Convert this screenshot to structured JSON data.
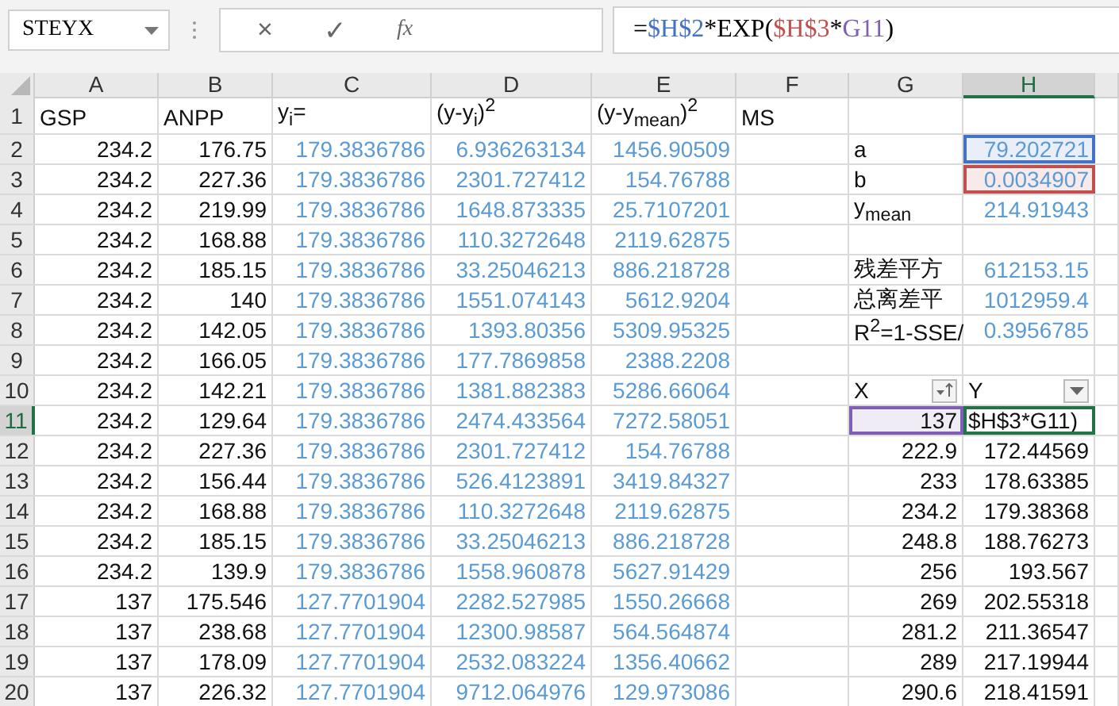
{
  "formula_bar": {
    "name_box": "STEYX",
    "cancel": "×",
    "enter": "✓",
    "function": "fx",
    "formula": [
      {
        "text": "=",
        "color": "#000000"
      },
      {
        "text": "$H$2",
        "color": "#4472c4"
      },
      {
        "text": "*EXP(",
        "color": "#000000"
      },
      {
        "text": "$H$3",
        "color": "#c0504d"
      },
      {
        "text": "*",
        "color": "#000000"
      },
      {
        "text": "G11",
        "color": "#7f5fb5"
      },
      {
        "text": ")",
        "color": "#000000"
      }
    ]
  },
  "columns": [
    {
      "label": "A",
      "selected": false
    },
    {
      "label": "B",
      "selected": false
    },
    {
      "label": "C",
      "selected": false
    },
    {
      "label": "D",
      "selected": false
    },
    {
      "label": "E",
      "selected": false
    },
    {
      "label": "F",
      "selected": false
    },
    {
      "label": "G",
      "selected": false
    },
    {
      "label": "H",
      "selected": true
    }
  ],
  "rows": [
    {
      "number": "1",
      "selected": false,
      "cells": [
        {
          "kind": "label",
          "text": "GSP"
        },
        {
          "kind": "label",
          "text": "ANPP"
        },
        {
          "kind": "label",
          "text": "y$_{i}$="
        },
        {
          "kind": "label",
          "text": "(y-y$_{i}$)$^{2}$"
        },
        {
          "kind": "label",
          "text": "(y-y$_{mean}$)$^{2}$"
        },
        {
          "kind": "label",
          "text": "MS"
        },
        {
          "kind": "empty"
        },
        {
          "kind": "empty"
        }
      ]
    },
    {
      "number": "2",
      "selected": false,
      "cells": [
        {
          "kind": "number",
          "text": "234.2"
        },
        {
          "kind": "number",
          "text": "176.75"
        },
        {
          "kind": "calc",
          "text": "179.3836786"
        },
        {
          "kind": "calc",
          "text": "6.936263134"
        },
        {
          "kind": "calc",
          "text": "1456.90509"
        },
        {
          "kind": "empty"
        },
        {
          "kind": "label",
          "text": "a"
        },
        {
          "kind": "calc",
          "text": "79.202721",
          "color": "#4472c4"
        }
      ]
    },
    {
      "number": "3",
      "selected": false,
      "cells": [
        {
          "kind": "number",
          "text": "234.2"
        },
        {
          "kind": "number",
          "text": "227.36"
        },
        {
          "kind": "calc",
          "text": "179.3836786"
        },
        {
          "kind": "calc",
          "text": "2301.727412"
        },
        {
          "kind": "calc",
          "text": "154.76788"
        },
        {
          "kind": "empty"
        },
        {
          "kind": "label",
          "text": "b"
        },
        {
          "kind": "calc",
          "text": "0.0034907",
          "color": "#c0504d"
        }
      ]
    },
    {
      "number": "4",
      "selected": false,
      "cells": [
        {
          "kind": "number",
          "text": "234.2"
        },
        {
          "kind": "number",
          "text": "219.99"
        },
        {
          "kind": "calc",
          "text": "179.3836786"
        },
        {
          "kind": "calc",
          "text": "1648.873335"
        },
        {
          "kind": "calc",
          "text": "25.7107201"
        },
        {
          "kind": "empty"
        },
        {
          "kind": "label",
          "text": "y$_{mean}$"
        },
        {
          "kind": "calc",
          "text": "214.91943"
        }
      ]
    },
    {
      "number": "5",
      "selected": false,
      "cells": [
        {
          "kind": "number",
          "text": "234.2"
        },
        {
          "kind": "number",
          "text": "168.88"
        },
        {
          "kind": "calc",
          "text": "179.3836786"
        },
        {
          "kind": "calc",
          "text": "110.3272648"
        },
        {
          "kind": "calc",
          "text": "2119.62875"
        },
        {
          "kind": "empty"
        },
        {
          "kind": "empty"
        },
        {
          "kind": "empty"
        }
      ]
    },
    {
      "number": "6",
      "selected": false,
      "cells": [
        {
          "kind": "number",
          "text": "234.2"
        },
        {
          "kind": "number",
          "text": "185.15"
        },
        {
          "kind": "calc",
          "text": "179.3836786"
        },
        {
          "kind": "calc",
          "text": "33.25046213"
        },
        {
          "kind": "calc",
          "text": "886.218728"
        },
        {
          "kind": "empty"
        },
        {
          "kind": "label",
          "text": "残差平方"
        },
        {
          "kind": "calc",
          "text": "612153.15"
        }
      ]
    },
    {
      "number": "7",
      "selected": false,
      "cells": [
        {
          "kind": "number",
          "text": "234.2"
        },
        {
          "kind": "number",
          "text": "140"
        },
        {
          "kind": "calc",
          "text": "179.3836786"
        },
        {
          "kind": "calc",
          "text": "1551.074143"
        },
        {
          "kind": "calc",
          "text": "5612.9204"
        },
        {
          "kind": "empty"
        },
        {
          "kind": "label",
          "text": "总离差平"
        },
        {
          "kind": "calc",
          "text": "1012959.4"
        }
      ]
    },
    {
      "number": "8",
      "selected": false,
      "cells": [
        {
          "kind": "number",
          "text": "234.2"
        },
        {
          "kind": "number",
          "text": "142.05"
        },
        {
          "kind": "calc",
          "text": "179.3836786"
        },
        {
          "kind": "calc",
          "text": "1393.80356"
        },
        {
          "kind": "calc",
          "text": "5309.95325"
        },
        {
          "kind": "empty"
        },
        {
          "kind": "label",
          "text": "R$^{2}$=1-SSE/"
        },
        {
          "kind": "calc",
          "text": "0.3956785"
        }
      ]
    },
    {
      "number": "9",
      "selected": false,
      "cells": [
        {
          "kind": "number",
          "text": "234.2"
        },
        {
          "kind": "number",
          "text": "166.05"
        },
        {
          "kind": "calc",
          "text": "179.3836786"
        },
        {
          "kind": "calc",
          "text": "177.7869858"
        },
        {
          "kind": "calc",
          "text": "2388.2208"
        },
        {
          "kind": "empty"
        },
        {
          "kind": "empty"
        },
        {
          "kind": "empty"
        }
      ]
    },
    {
      "number": "10",
      "selected": false,
      "cells": [
        {
          "kind": "number",
          "text": "234.2"
        },
        {
          "kind": "number",
          "text": "142.21"
        },
        {
          "kind": "calc",
          "text": "179.3836786"
        },
        {
          "kind": "calc",
          "text": "1381.882383"
        },
        {
          "kind": "calc",
          "text": "5286.66064"
        },
        {
          "kind": "empty"
        },
        {
          "kind": "sortlabel",
          "text": "X"
        },
        {
          "kind": "filterlabel",
          "text": "Y"
        }
      ]
    },
    {
      "number": "11",
      "selected": true,
      "cells": [
        {
          "kind": "number",
          "text": "234.2"
        },
        {
          "kind": "number",
          "text": "129.64"
        },
        {
          "kind": "calc",
          "text": "179.3836786"
        },
        {
          "kind": "calc",
          "text": "2474.433564"
        },
        {
          "kind": "calc",
          "text": "7272.58051"
        },
        {
          "kind": "empty"
        },
        {
          "kind": "number",
          "text": "137",
          "color": "#7f5fb5"
        },
        {
          "kind": "editing",
          "text": "$H$3*G11)",
          "color": "#217346"
        }
      ]
    },
    {
      "number": "12",
      "selected": false,
      "cells": [
        {
          "kind": "number",
          "text": "234.2"
        },
        {
          "kind": "number",
          "text": "227.36"
        },
        {
          "kind": "calc",
          "text": "179.3836786"
        },
        {
          "kind": "calc",
          "text": "2301.727412"
        },
        {
          "kind": "calc",
          "text": "154.76788"
        },
        {
          "kind": "empty"
        },
        {
          "kind": "number",
          "text": "222.9"
        },
        {
          "kind": "number",
          "text": "172.44569"
        }
      ]
    },
    {
      "number": "13",
      "selected": false,
      "cells": [
        {
          "kind": "number",
          "text": "234.2"
        },
        {
          "kind": "number",
          "text": "156.44"
        },
        {
          "kind": "calc",
          "text": "179.3836786"
        },
        {
          "kind": "calc",
          "text": "526.4123891"
        },
        {
          "kind": "calc",
          "text": "3419.84327"
        },
        {
          "kind": "empty"
        },
        {
          "kind": "number",
          "text": "233"
        },
        {
          "kind": "number",
          "text": "178.63385"
        }
      ]
    },
    {
      "number": "14",
      "selected": false,
      "cells": [
        {
          "kind": "number",
          "text": "234.2"
        },
        {
          "kind": "number",
          "text": "168.88"
        },
        {
          "kind": "calc",
          "text": "179.3836786"
        },
        {
          "kind": "calc",
          "text": "110.3272648"
        },
        {
          "kind": "calc",
          "text": "2119.62875"
        },
        {
          "kind": "empty"
        },
        {
          "kind": "number",
          "text": "234.2"
        },
        {
          "kind": "number",
          "text": "179.38368"
        }
      ]
    },
    {
      "number": "15",
      "selected": false,
      "cells": [
        {
          "kind": "number",
          "text": "234.2"
        },
        {
          "kind": "number",
          "text": "185.15"
        },
        {
          "kind": "calc",
          "text": "179.3836786"
        },
        {
          "kind": "calc",
          "text": "33.25046213"
        },
        {
          "kind": "calc",
          "text": "886.218728"
        },
        {
          "kind": "empty"
        },
        {
          "kind": "number",
          "text": "248.8"
        },
        {
          "kind": "number",
          "text": "188.76273"
        }
      ]
    },
    {
      "number": "16",
      "selected": false,
      "cells": [
        {
          "kind": "number",
          "text": "234.2"
        },
        {
          "kind": "number",
          "text": "139.9"
        },
        {
          "kind": "calc",
          "text": "179.3836786"
        },
        {
          "kind": "calc",
          "text": "1558.960878"
        },
        {
          "kind": "calc",
          "text": "5627.91429"
        },
        {
          "kind": "empty"
        },
        {
          "kind": "number",
          "text": "256"
        },
        {
          "kind": "number",
          "text": "193.567"
        }
      ]
    },
    {
      "number": "17",
      "selected": false,
      "cells": [
        {
          "kind": "number",
          "text": "137"
        },
        {
          "kind": "number",
          "text": "175.546"
        },
        {
          "kind": "calc",
          "text": "127.7701904"
        },
        {
          "kind": "calc",
          "text": "2282.527985"
        },
        {
          "kind": "calc",
          "text": "1550.26668"
        },
        {
          "kind": "empty"
        },
        {
          "kind": "number",
          "text": "269"
        },
        {
          "kind": "number",
          "text": "202.55318"
        }
      ]
    },
    {
      "number": "18",
      "selected": false,
      "cells": [
        {
          "kind": "number",
          "text": "137"
        },
        {
          "kind": "number",
          "text": "238.68"
        },
        {
          "kind": "calc",
          "text": "127.7701904"
        },
        {
          "kind": "calc",
          "text": "12300.98587"
        },
        {
          "kind": "calc",
          "text": "564.564874"
        },
        {
          "kind": "empty"
        },
        {
          "kind": "number",
          "text": "281.2"
        },
        {
          "kind": "number",
          "text": "211.36547"
        }
      ]
    },
    {
      "number": "19",
      "selected": false,
      "cells": [
        {
          "kind": "number",
          "text": "137"
        },
        {
          "kind": "number",
          "text": "178.09"
        },
        {
          "kind": "calc",
          "text": "127.7701904"
        },
        {
          "kind": "calc",
          "text": "2532.083224"
        },
        {
          "kind": "calc",
          "text": "1356.40662"
        },
        {
          "kind": "empty"
        },
        {
          "kind": "number",
          "text": "289"
        },
        {
          "kind": "number",
          "text": "217.19944"
        }
      ]
    },
    {
      "number": "20",
      "selected": false,
      "cells": [
        {
          "kind": "number",
          "text": "137"
        },
        {
          "kind": "number",
          "text": "226.32"
        },
        {
          "kind": "calc",
          "text": "127.7701904"
        },
        {
          "kind": "calc",
          "text": "9712.064976"
        },
        {
          "kind": "calc",
          "text": "129.973086"
        },
        {
          "kind": "empty"
        },
        {
          "kind": "number",
          "text": "290.6"
        },
        {
          "kind": "number",
          "text": "218.41591"
        }
      ]
    }
  ]
}
